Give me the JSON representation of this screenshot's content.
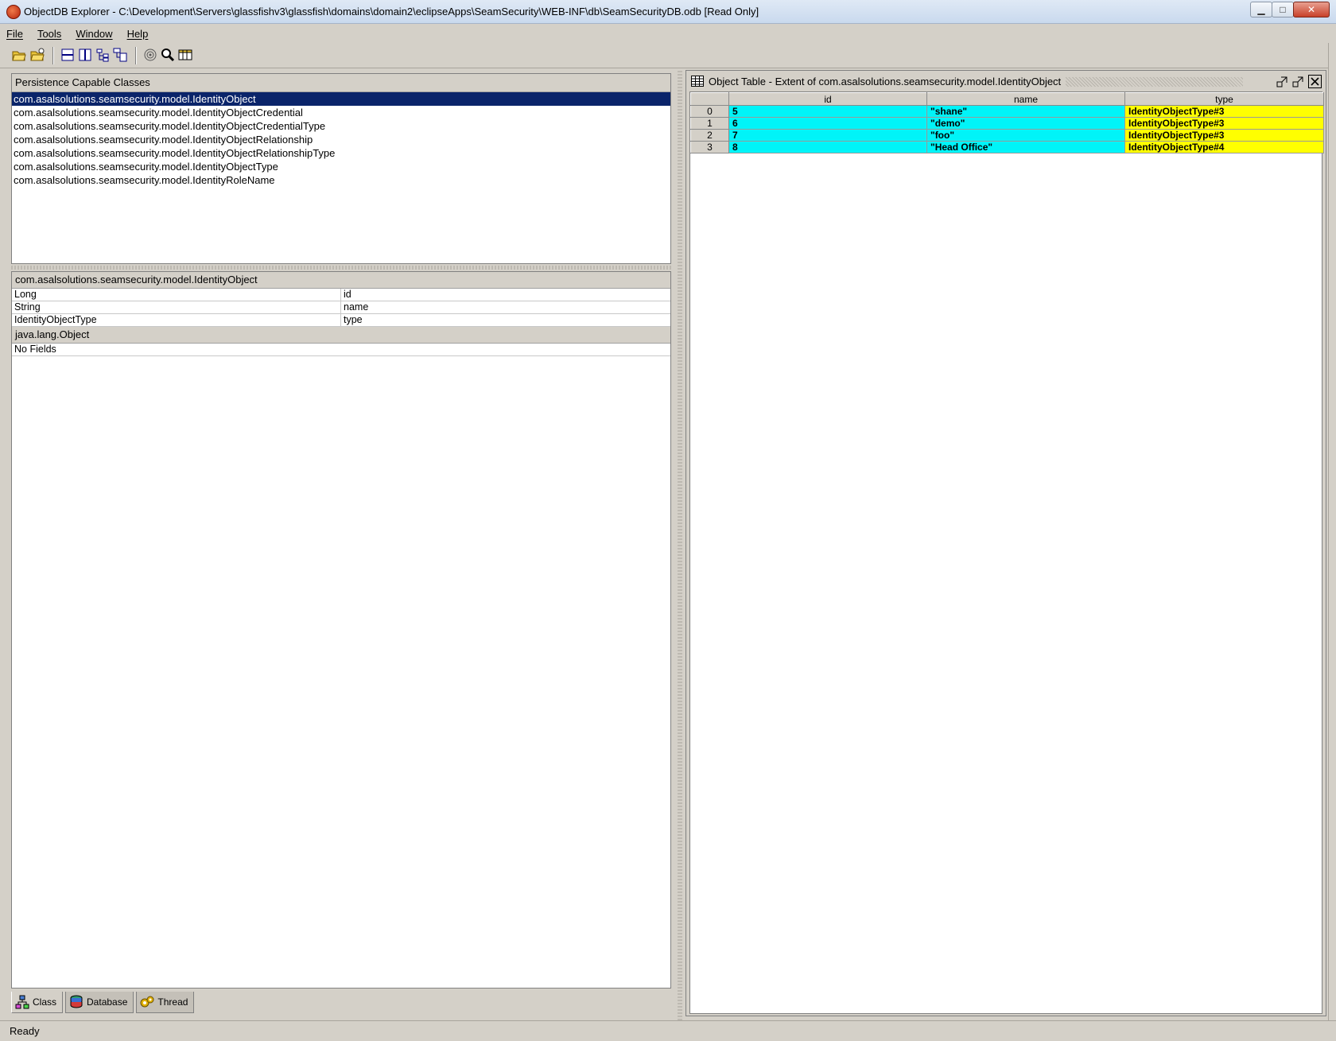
{
  "window": {
    "title": "ObjectDB Explorer - C:\\Development\\Servers\\glassfishv3\\glassfish\\domains\\domain2\\eclipseApps\\SeamSecurity\\WEB-INF\\db\\SeamSecurityDB.odb [Read Only]",
    "minimize_glyph": "▁",
    "maximize_glyph": "□",
    "close_glyph": "✕"
  },
  "menu": [
    "File",
    "Tools",
    "Window",
    "Help"
  ],
  "toolbar": {
    "icons": [
      "open-folder-icon",
      "open-recent-icon",
      "split-horizontal-icon",
      "split-vertical-icon",
      "tree-view-icon",
      "tree-table-icon",
      "target-icon",
      "zoom-icon",
      "table-view-icon"
    ]
  },
  "classes_panel": {
    "header": "Persistence Capable Classes",
    "items": [
      "com.asalsolutions.seamsecurity.model.IdentityObject",
      "com.asalsolutions.seamsecurity.model.IdentityObjectCredential",
      "com.asalsolutions.seamsecurity.model.IdentityObjectCredentialType",
      "com.asalsolutions.seamsecurity.model.IdentityObjectRelationship",
      "com.asalsolutions.seamsecurity.model.IdentityObjectRelationshipType",
      "com.asalsolutions.seamsecurity.model.IdentityObjectType",
      "com.asalsolutions.seamsecurity.model.IdentityRoleName"
    ],
    "selected_index": 0
  },
  "fields_panel": {
    "class_header": "com.asalsolutions.seamsecurity.model.IdentityObject",
    "fields": [
      {
        "type": "Long",
        "name": "id"
      },
      {
        "type": "String",
        "name": "name"
      },
      {
        "type": "IdentityObjectType",
        "name": "type"
      }
    ],
    "super_header": "java.lang.Object",
    "super_fields_text": "No Fields"
  },
  "bottom_tabs": [
    {
      "label": "Class",
      "icon": "class-icon",
      "active": true
    },
    {
      "label": "Database",
      "icon": "database-icon",
      "active": false
    },
    {
      "label": "Thread",
      "icon": "thread-icon",
      "active": false
    }
  ],
  "object_table": {
    "title": "Object Table - Extent of com.asalsolutions.seamsecurity.model.IdentityObject",
    "columns": [
      "",
      "id",
      "name",
      "type"
    ],
    "rows": [
      {
        "index": "0",
        "id": "5",
        "name": "\"shane\"",
        "type": "IdentityObjectType#3"
      },
      {
        "index": "1",
        "id": "6",
        "name": "\"demo\"",
        "type": "IdentityObjectType#3"
      },
      {
        "index": "2",
        "id": "7",
        "name": "\"foo\"",
        "type": "IdentityObjectType#3"
      },
      {
        "index": "3",
        "id": "8",
        "name": "\"Head Office\"",
        "type": "IdentityObjectType#4"
      }
    ],
    "colors": {
      "id_cell": "#00f4f8",
      "name_cell": "#00f4f8",
      "type_cell": "#ffff00"
    }
  },
  "status": {
    "text": "Ready"
  }
}
